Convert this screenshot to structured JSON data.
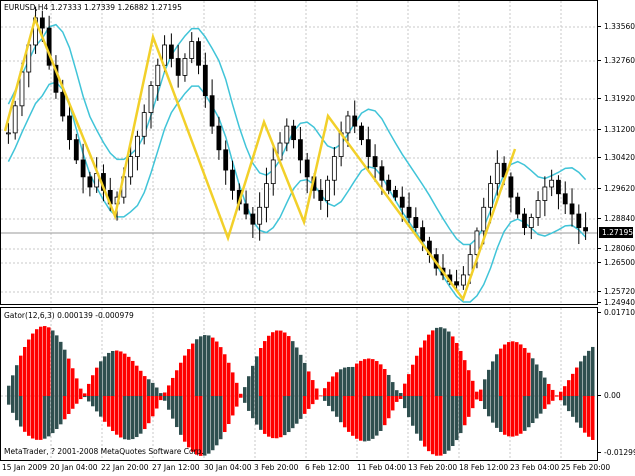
{
  "chart": {
    "symbol_label": "EURUSD,H4  1.27333 1.27339 1.26882 1.27195",
    "current_price": "1.27195",
    "price_ticks": [
      "1.33560",
      "1.32760",
      "1.31920",
      "1.31200",
      "1.30420",
      "1.29620",
      "1.28840",
      "1.28060",
      "1.27195",
      "1.26500",
      "1.25720",
      "1.24940"
    ],
    "colors": {
      "bands": "#40c4d8",
      "zigzag": "#f2d02a",
      "candles": "#000000",
      "gator_up": "#ff0000",
      "gator_down": "#2f4f4f"
    }
  },
  "indicator": {
    "title": "Gator(12,6,3) 0.000139 -0.000979",
    "ticks": [
      "0.017108",
      "0.00",
      "-0.01299"
    ],
    "copyright": "MetaTrader, ? 2001-2008 MetaQuotes Software Corp."
  },
  "time_axis": {
    "labels": [
      "15 Jan 2009",
      "20 Jan 04:00",
      "22 Jan 20:00",
      "27 Jan 12:00",
      "30 Jan 04:00",
      "3 Feb 20:00",
      "6 Feb 12:00",
      "11 Feb 04:00",
      "13 Feb 20:00",
      "18 Feb 12:00",
      "23 Feb 04:00",
      "25 Feb 20:00"
    ]
  },
  "chart_data": {
    "type": "candlestick",
    "title": "EURUSD,H4",
    "ylim": [
      1.2494,
      1.339
    ],
    "closes": [
      1.3,
      1.308,
      1.318,
      1.326,
      1.334,
      1.331,
      1.32,
      1.312,
      1.305,
      1.298,
      1.292,
      1.287,
      1.284,
      1.288,
      1.283,
      1.279,
      1.281,
      1.287,
      1.293,
      1.299,
      1.306,
      1.314,
      1.32,
      1.326,
      1.322,
      1.317,
      1.322,
      1.327,
      1.32,
      1.311,
      1.302,
      1.295,
      1.289,
      1.283,
      1.279,
      1.276,
      1.273,
      1.278,
      1.285,
      1.292,
      1.297,
      1.302,
      1.298,
      1.292,
      1.287,
      1.283,
      1.28,
      1.286,
      1.293,
      1.3,
      1.305,
      1.302,
      1.298,
      1.293,
      1.29,
      1.286,
      1.283,
      1.281,
      1.278,
      1.275,
      1.272,
      1.268,
      1.264,
      1.26,
      1.258,
      1.256,
      1.255,
      1.258,
      1.264,
      1.271,
      1.278,
      1.285,
      1.291,
      1.287,
      1.281,
      1.276,
      1.272,
      1.275,
      1.28,
      1.284,
      1.286,
      1.282,
      1.279,
      1.276,
      1.272,
      1.271
    ]
  }
}
